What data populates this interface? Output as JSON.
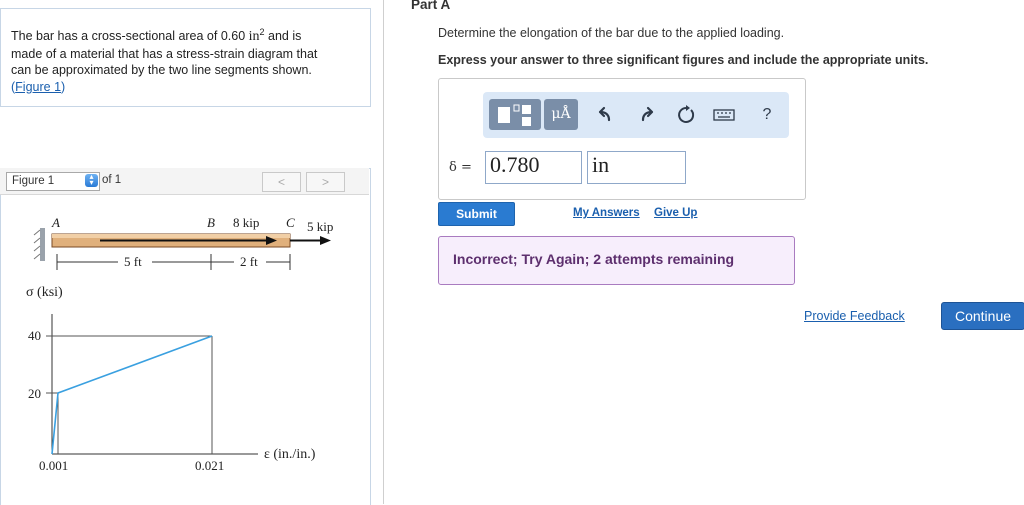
{
  "problem": {
    "line1_a": "The bar has a cross-sectional area of 0.60 ",
    "line1_unit": "in",
    "line1_sup": "2",
    "line1_b": " and is",
    "line2": "made of a material that has a stress-strain diagram that",
    "line3": "can be approximated by the two line segments shown.",
    "link_open": "(",
    "link": "Figure 1",
    "link_close": ")"
  },
  "figure_nav": {
    "selected": "Figure 1",
    "of_label": "of 1",
    "prev": "<",
    "next": ">"
  },
  "figure": {
    "point_a": "A",
    "point_b": "B",
    "point_c": "C",
    "load_b": "8 kip",
    "load_c": "5 kip",
    "dim_ab": "5 ft",
    "dim_bc": "2 ft",
    "stress_label": "σ (ksi)",
    "strain_label": "ε (in./in.)",
    "y_tick_40": "40",
    "y_tick_20": "20",
    "x_tick_1": "0.001",
    "x_tick_2": "0.021"
  },
  "part": {
    "title": "Part A",
    "instruction": "Determine the elongation of the bar due to the applied loading.",
    "instruction_bold": "Express your answer to three significant figures and include the appropriate units."
  },
  "toolbar": {
    "units_label": "μÅ",
    "undo_icon": "undo-icon",
    "redo_icon": "redo-icon",
    "reset_icon": "reset-icon",
    "keyboard_icon": "keyboard-icon",
    "help_label": "?"
  },
  "answer": {
    "symbol_label": "δ =",
    "value": "0.780",
    "unit": "in"
  },
  "actions": {
    "submit": "Submit",
    "my_answers": "My Answers",
    "give_up": "Give Up",
    "feedback": "Incorrect; Try Again; 2 attempts remaining",
    "provide_feedback": "Provide Feedback",
    "continue": "Continue"
  },
  "colors": {
    "link": "#1a5fae",
    "submit": "#2a7bd1",
    "feedback_bg": "#f7eefc",
    "feedback_border": "#a97bc0",
    "bar_fill": "#e0b07c",
    "curve": "#3aa0e0"
  }
}
